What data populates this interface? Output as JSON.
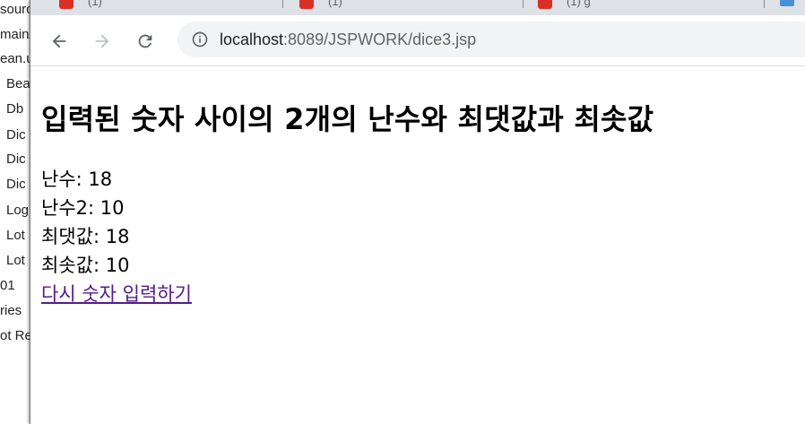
{
  "ide": {
    "rows": [
      "sourc",
      "main/",
      "ean.u",
      "Bea",
      "Db",
      "Dic",
      "Dic",
      "Dic",
      "Log",
      "Lot",
      "Lot",
      "01",
      "ries",
      "ot Re"
    ]
  },
  "browser": {
    "tabs": [
      {
        "label": "(1)"
      },
      {
        "label": "(1)"
      },
      {
        "label": "(1)                      g"
      }
    ],
    "url_host": "localhost",
    "url_path": ":8089/JSPWORK/dice3.jsp"
  },
  "page": {
    "heading": "입력된 숫자 사이의 2개의 난수와 최댓값과 최솟값",
    "random1": "난수: 18",
    "random2": "난수2: 10",
    "max": "최댓값: 18",
    "min": "최솟값: 10",
    "retry_link": "다시 숫자 입력하기"
  },
  "colors": {
    "tabstrip": "#dee1e6",
    "omnibox": "#f1f3f4",
    "visited_link": "#551a8b"
  }
}
